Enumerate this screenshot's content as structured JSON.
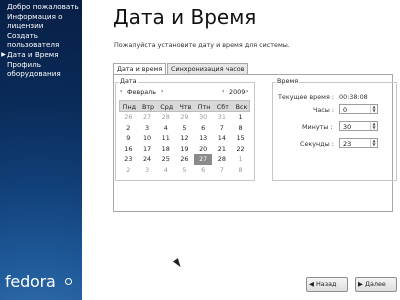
{
  "sidebar": {
    "items": [
      {
        "label": "Добро пожаловать",
        "current": false
      },
      {
        "label": "Информация о\nлицензии",
        "current": false
      },
      {
        "label": "Создать\nпользователя",
        "current": false
      },
      {
        "label": "Дата и Время",
        "current": true
      },
      {
        "label": "Профиль\nоборудования",
        "current": false
      }
    ],
    "logo_text": "fedora"
  },
  "page": {
    "title": "Дата и Время",
    "subtitle": "Пожалуйста установите дату и время для системы."
  },
  "tabs": [
    {
      "label": "Дата и время",
      "active": true
    },
    {
      "label": "Синхронизация часов",
      "active": false
    }
  ],
  "date_frame": {
    "label": "Дата",
    "month": "Февраль",
    "year": "2009",
    "weekdays": [
      "Пнд",
      "Втр",
      "Срд",
      "Чтв",
      "Птн",
      "Сбт",
      "Вск"
    ],
    "weeks": [
      [
        "26",
        "27",
        "28",
        "29",
        "30",
        "31",
        "1"
      ],
      [
        "2",
        "3",
        "4",
        "5",
        "6",
        "7",
        "8"
      ],
      [
        "9",
        "10",
        "11",
        "12",
        "13",
        "14",
        "15"
      ],
      [
        "16",
        "17",
        "18",
        "19",
        "20",
        "21",
        "22"
      ],
      [
        "23",
        "24",
        "25",
        "26",
        "27",
        "28",
        "1"
      ],
      [
        "2",
        "3",
        "4",
        "5",
        "6",
        "7",
        "8"
      ]
    ],
    "selected_day": "27"
  },
  "time_frame": {
    "label": "Время",
    "current_time_label": "Текущее время :",
    "current_time_value": "00:38:08",
    "hours_label": "Часы :",
    "hours_value": "0",
    "minutes_label": "Минуты :",
    "minutes_value": "30",
    "seconds_label": "Секунды :",
    "seconds_value": "23"
  },
  "buttons": {
    "back_label": "Назад",
    "next_label": "Далее"
  },
  "colors": {
    "sidebar_bg": "#0f3a72",
    "selected_day_bg": "#8a8a8a"
  }
}
